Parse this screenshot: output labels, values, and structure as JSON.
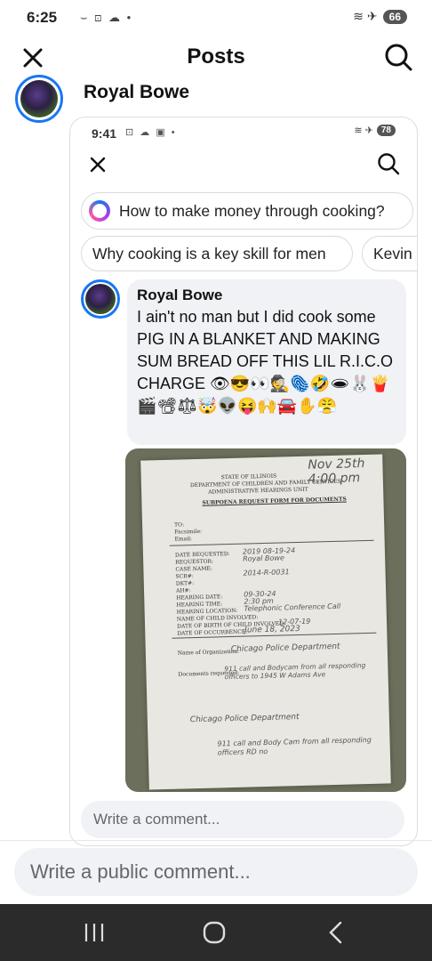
{
  "status_bar": {
    "time": "6:25",
    "left_icons": "⌣ ⊡ ☁ •",
    "right_icons": "≋ ✈",
    "battery": "66"
  },
  "header": {
    "title": "Posts"
  },
  "post": {
    "author": "Royal Bowe"
  },
  "embedded": {
    "status_time": "9:41",
    "status_left_icons": "⊡ ☁ ▣ •",
    "status_right_icons": "≋ ✈",
    "battery": "78",
    "ai_suggestion": "How to make money through cooking?",
    "chips": [
      "Why cooking is a key skill for men",
      "Kevin"
    ],
    "comment": {
      "author": "Royal Bowe",
      "text": "I ain't no man but I did cook some PIG IN A BLANKET AND MAKING SUM BREAD OFF THIS LIL R.I.C.O CHARGE 👁😎👀🕵🫆🤣🕳🐰🍟🎬📽⚖🤯👽😝🙌🚘✋😤"
    },
    "document": {
      "header_lines": [
        "STATE OF ILLINOIS",
        "DEPARTMENT OF CHILDREN AND FAMILY SERVICES",
        "ADMINISTRATIVE HEARINGS UNIT"
      ],
      "form_title": "SUBPOENA REQUEST FORM FOR DOCUMENTS",
      "handwritten_note": "Nov 25th 4:00 pm",
      "fields": [
        "TO:",
        "Facsimile:",
        "Email:",
        "DATE REQUESTED:",
        "REQUESTOR:",
        "CASE NAME:",
        "SCR#:",
        "DKT#:",
        "AH#:",
        "HEARING DATE:",
        "HEARING TIME:",
        "HEARING LOCATION:",
        "NAME OF CHILD INVOLVED:",
        "DATE OF BIRTH OF CHILD INVOLVED:",
        "DATE OF OCCURRENCE:"
      ],
      "hand_values": [
        "2019 08-19-24",
        "Royal Bowe",
        "",
        "2014-R-0031",
        "",
        "09-30-24",
        "2:30 pm",
        "Telephonic Conference Call",
        "",
        "12-07-19",
        "June 18, 2023"
      ],
      "org_label": "Name of Organization:",
      "org_value": "Chicago Police Department",
      "docs_label": "Documents requested:",
      "docs_value": "911 call and Bodycam from all responding officers to 1945 W Adams Ave",
      "org2_value": "Chicago Police Department",
      "docs2_value": "911 call and Body Cam from all responding officers RD no"
    },
    "comment_placeholder": "Write a comment..."
  },
  "bottom": {
    "public_comment_placeholder": "Write a public comment..."
  },
  "colors": {
    "accent": "#1877f2",
    "navbar": "#2b2b2b",
    "input_bg": "#f0f2f5"
  }
}
